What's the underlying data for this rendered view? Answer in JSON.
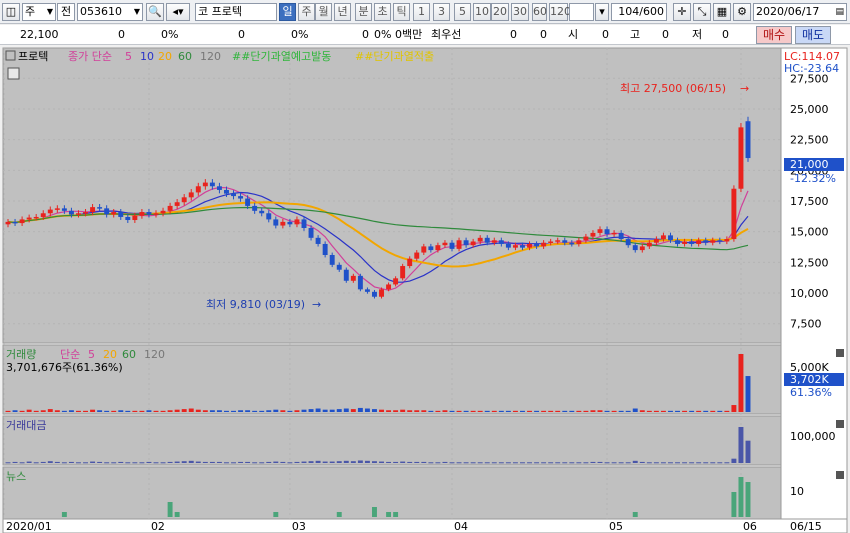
{
  "toolbar": {
    "market": "주",
    "prev_label": "전",
    "code": "053610",
    "name_prefix": "코",
    "name": "프로텍",
    "timeframes": [
      "일",
      "주",
      "월",
      "년",
      "분",
      "초",
      "틱"
    ],
    "minutes": [
      "1",
      "3",
      "5",
      "10",
      "20",
      "30",
      "60",
      "120"
    ],
    "count": "104/600",
    "date": "2020/06/17"
  },
  "quote": {
    "price": "22,100",
    "v1": "0",
    "p1": "0%",
    "v2": "0",
    "p2": "0%",
    "v3": "0",
    "p3": "0%",
    "v4": "0백만",
    "best_label": "최우선",
    "v5": "0",
    "v6": "0",
    "lbl_si": "시",
    "v7": "0",
    "lbl_go": "고",
    "v8": "0",
    "lbl_jeo": "저",
    "v9": "0",
    "buy": "매수",
    "sell": "매도"
  },
  "price_panel": {
    "name": "프로텍",
    "ma_label": "종가 단순",
    "ma": [
      "5",
      "10",
      "20",
      "60",
      "120"
    ],
    "ind1": "##단기과열예고발동",
    "ind2": "##단기과열적출",
    "high_label": "최고 27,500 (06/15)",
    "low_label": "최저 9,810 (03/19)",
    "lc": "LC:114.07",
    "hc": "HC:-23.64",
    "y_ticks": [
      "27,500",
      "25,000",
      "22,500",
      "20,000",
      "17,500",
      "15,000",
      "12,500",
      "10,000",
      "7,500"
    ],
    "current": "21,000",
    "change": "-12.32%"
  },
  "volume_panel": {
    "name": "거래량",
    "ma_label": "단순",
    "ma": [
      "5",
      "20",
      "60",
      "120"
    ],
    "info": "3,701,676주(61.36%)",
    "tick": "5,000K",
    "current": "3,702K",
    "pct": "61.36%"
  },
  "amount_panel": {
    "name": "거래대금",
    "tick": "100,000"
  },
  "news_panel": {
    "name": "뉴스",
    "tick": "10"
  },
  "x_axis": {
    "labels": [
      "2020/01",
      "02",
      "03",
      "04",
      "05",
      "06"
    ],
    "cursor": "06/15"
  },
  "colors": {
    "up": "#e8231e",
    "down": "#1f51c9",
    "ma5": "#d1409a",
    "ma10": "#2a33c8",
    "ma20": "#f2a600",
    "ma60": "#2f8a3c",
    "ma120": "#888888",
    "news": "#4aa57a",
    "bg": "#c0c0c0"
  },
  "chart_data": {
    "type": "candlestick",
    "ylim": [
      6500,
      28500
    ],
    "close": [
      15800,
      15700,
      16000,
      16150,
      16200,
      16500,
      16800,
      16900,
      16700,
      16400,
      16500,
      16600,
      17000,
      16900,
      16400,
      16600,
      16200,
      15950,
      16300,
      16600,
      16400,
      16500,
      16700,
      17100,
      17400,
      17800,
      18200,
      18700,
      19000,
      18700,
      18400,
      18100,
      17900,
      17700,
      17100,
      16700,
      16500,
      16000,
      15500,
      15800,
      15600,
      16000,
      15300,
      14500,
      14000,
      13100,
      12300,
      11900,
      11000,
      11400,
      10300,
      10100,
      9700,
      10300,
      10700,
      11200,
      12200,
      12800,
      13300,
      13800,
      13500,
      13900,
      14100,
      13600,
      14300,
      13900,
      14200,
      14500,
      14100,
      14300,
      14000,
      13700,
      13900,
      13700,
      14000,
      13800,
      14100,
      14200,
      14300,
      14100,
      14000,
      14300,
      14600,
      14900,
      15200,
      14800,
      14900,
      14400,
      13900,
      13500,
      13800,
      14100,
      14400,
      14700,
      14300,
      14000,
      14200,
      14000,
      14300,
      14100,
      14300,
      14200,
      14400,
      18500,
      23500,
      21000
    ],
    "open": [
      15600,
      15800,
      15700,
      16000,
      16150,
      16200,
      16500,
      16800,
      16900,
      16700,
      16400,
      16500,
      16600,
      17000,
      16900,
      16400,
      16600,
      16200,
      15950,
      16300,
      16600,
      16400,
      16500,
      16700,
      17100,
      17400,
      17800,
      18200,
      18700,
      19000,
      18700,
      18400,
      18100,
      17900,
      17700,
      17100,
      16700,
      16500,
      16000,
      15500,
      15800,
      15600,
      16000,
      15300,
      14500,
      14000,
      13100,
      12300,
      11900,
      11000,
      11400,
      10300,
      10100,
      9700,
      10300,
      10700,
      11200,
      12200,
      12800,
      13300,
      13800,
      13500,
      13900,
      14100,
      13600,
      14300,
      13900,
      14200,
      14500,
      14100,
      14300,
      14000,
      13700,
      13900,
      13700,
      14000,
      13800,
      14100,
      14200,
      14300,
      14100,
      14000,
      14300,
      14600,
      14900,
      15200,
      14800,
      14900,
      14400,
      13900,
      13500,
      13800,
      14100,
      14400,
      14700,
      14300,
      14000,
      14200,
      14000,
      14300,
      14100,
      14300,
      14200,
      14400,
      18500,
      24000
    ],
    "volume_ratio": [
      0.02,
      0.03,
      0.02,
      0.04,
      0.02,
      0.03,
      0.05,
      0.03,
      0.02,
      0.03,
      0.02,
      0.02,
      0.04,
      0.03,
      0.02,
      0.02,
      0.03,
      0.02,
      0.02,
      0.02,
      0.03,
      0.02,
      0.02,
      0.03,
      0.04,
      0.05,
      0.06,
      0.04,
      0.03,
      0.03,
      0.03,
      0.02,
      0.02,
      0.03,
      0.03,
      0.02,
      0.02,
      0.03,
      0.04,
      0.03,
      0.02,
      0.03,
      0.04,
      0.05,
      0.06,
      0.04,
      0.04,
      0.05,
      0.06,
      0.05,
      0.07,
      0.06,
      0.05,
      0.04,
      0.03,
      0.03,
      0.04,
      0.03,
      0.03,
      0.03,
      0.02,
      0.02,
      0.03,
      0.02,
      0.02,
      0.02,
      0.02,
      0.02,
      0.02,
      0.02,
      0.02,
      0.02,
      0.02,
      0.02,
      0.02,
      0.02,
      0.02,
      0.02,
      0.02,
      0.02,
      0.02,
      0.02,
      0.02,
      0.03,
      0.03,
      0.02,
      0.02,
      0.02,
      0.02,
      0.06,
      0.03,
      0.02,
      0.02,
      0.02,
      0.02,
      0.02,
      0.02,
      0.02,
      0.02,
      0.02,
      0.02,
      0.02,
      0.02,
      0.12,
      1.0,
      0.62
    ],
    "news": [
      0,
      0,
      0,
      0,
      0,
      0,
      0,
      0,
      1,
      0,
      0,
      0,
      0,
      0,
      0,
      0,
      0,
      0,
      0,
      0,
      0,
      0,
      0,
      3,
      1,
      0,
      0,
      0,
      0,
      0,
      0,
      0,
      0,
      0,
      0,
      0,
      0,
      0,
      1,
      0,
      0,
      0,
      0,
      0,
      0,
      0,
      0,
      1,
      0,
      0,
      0,
      0,
      2,
      0,
      1,
      1,
      0,
      0,
      0,
      0,
      0,
      0,
      0,
      0,
      0,
      0,
      0,
      0,
      0,
      0,
      0,
      0,
      0,
      0,
      0,
      0,
      0,
      0,
      0,
      0,
      0,
      0,
      0,
      0,
      0,
      0,
      0,
      0,
      0,
      1,
      0,
      0,
      0,
      0,
      0,
      0,
      0,
      0,
      0,
      0,
      0,
      0,
      0,
      5,
      8,
      7
    ]
  }
}
